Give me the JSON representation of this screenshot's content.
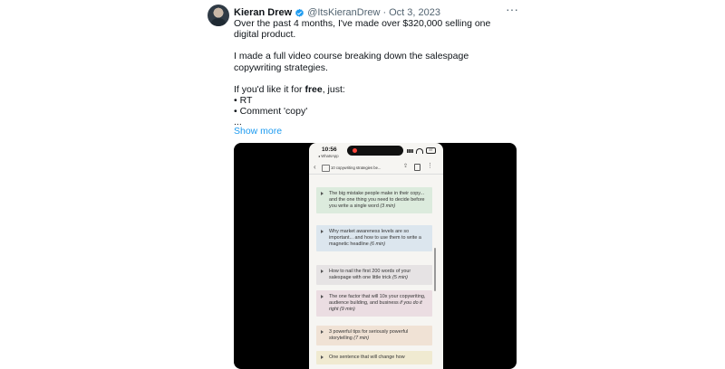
{
  "tweet": {
    "author_name": "Kieran Drew",
    "handle": "@ItsKieranDrew",
    "dot": "·",
    "date": "Oct 3, 2023",
    "more_icon": "more-dots-icon",
    "paragraph1": "Over the past 4 months, I've made over $320,000 selling one digital product.",
    "paragraph2": "I made a full video course breaking down the salespage copywriting strategies.",
    "line3_prefix": "If you'd like it for ",
    "line3_bold": "free",
    "line3_suffix": ", just:",
    "bullet1": "• RT",
    "bullet2": "• Comment 'copy'",
    "ellipsis": "...",
    "show_more": "Show more"
  },
  "media": {
    "status": {
      "time": "10:56",
      "back_app": "◂ WhatsApp",
      "battery": "97"
    },
    "nav": {
      "back": "‹",
      "title": "10 copywriting strategies be...",
      "share_icon": "share-icon",
      "menu": "⋮"
    },
    "cards": [
      {
        "text": "The big mistake people make in their copy... and the one thing you need to decide before you write a single word",
        "time": "(3 min)",
        "color": "#dcebdd"
      },
      {
        "text": "Why market awareness levels are so important... and how to use them to write a magnetic headline",
        "time": "(6 min)",
        "color": "#dce6ee"
      },
      {
        "text": "How to nail the first 200 words of your salespage with one little trick",
        "time": "(5 min)",
        "color": "#e6e3e4"
      },
      {
        "text": "The one factor that will 10x your copywriting, audience building, and business ",
        "em_text": "if you do it right",
        "time": "(9 min)",
        "color": "#ebdde2"
      },
      {
        "text": "3 powerful tips for seriously powerful storytelling",
        "time": "(7 min)",
        "color": "#f0e2d5"
      },
      {
        "text": "One sentence that will change how",
        "time": "",
        "color": "#f0ead1"
      }
    ]
  },
  "colors": {
    "verified": "#1d9bf0",
    "link": "#1d9bf0",
    "meta": "#536471"
  }
}
